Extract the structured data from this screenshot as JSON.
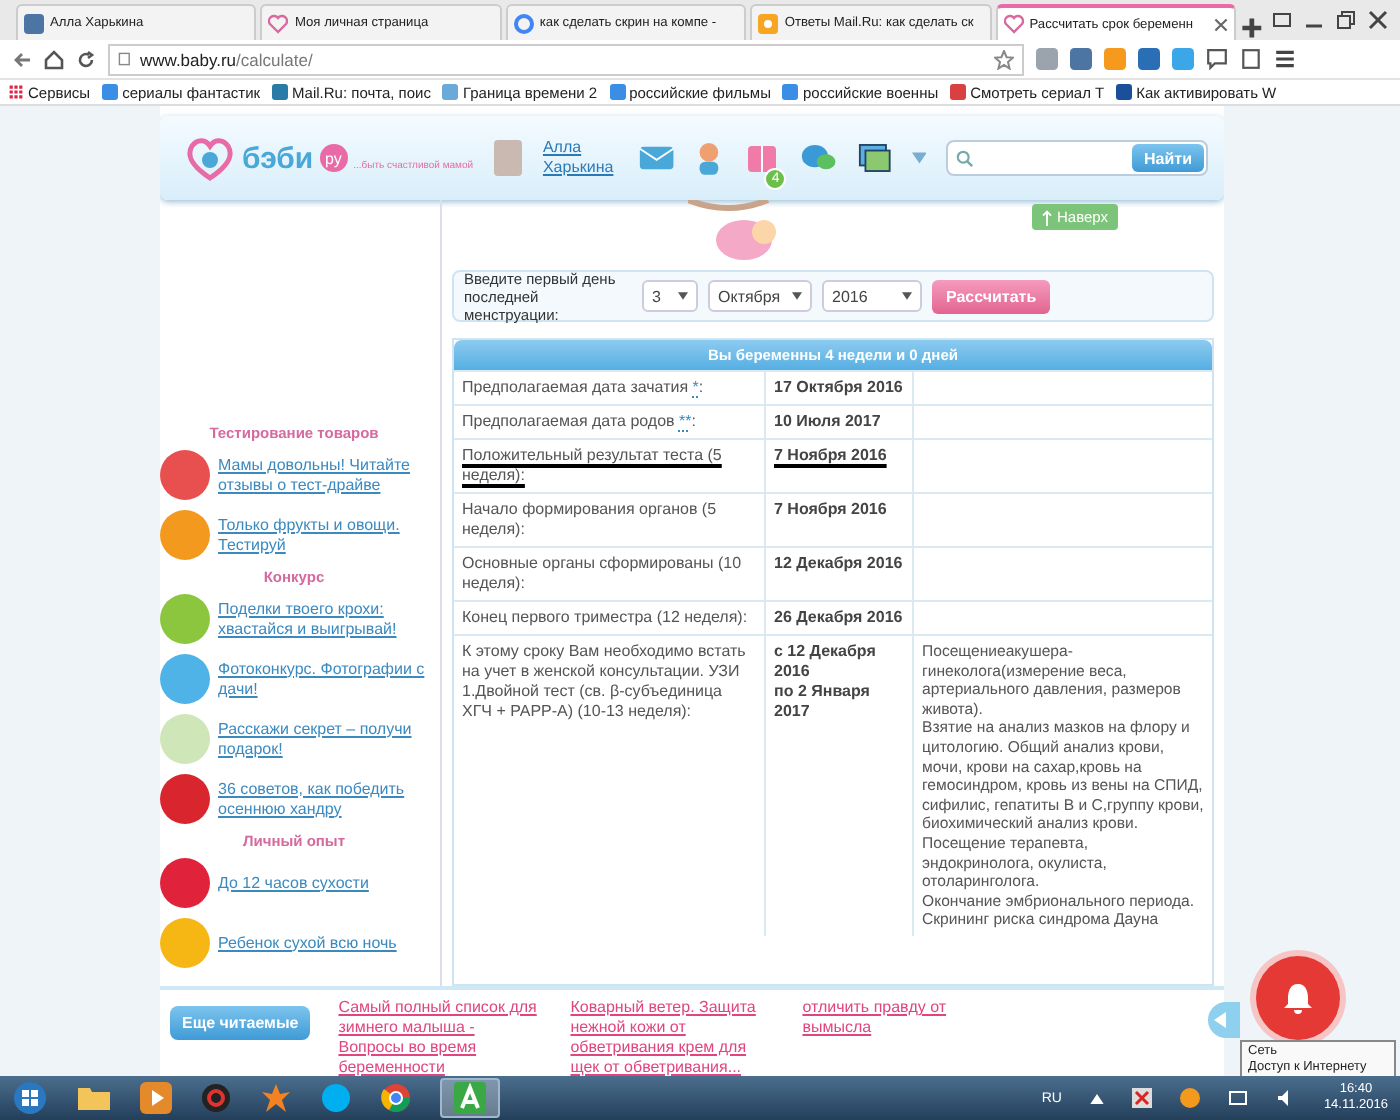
{
  "browser": {
    "tabs": [
      {
        "title": "Алла Харькина",
        "kind": "vk",
        "selected": false
      },
      {
        "title": "Моя личная страница",
        "kind": "baby",
        "selected": false
      },
      {
        "title": "как сделать скрин на компе -",
        "kind": "google",
        "selected": false
      },
      {
        "title": "Ответы Mail.Ru: как сделать ск",
        "kind": "answers",
        "selected": false
      },
      {
        "title": "Рассчитать срок беременн",
        "kind": "baby",
        "selected": true
      }
    ],
    "address": {
      "host": "www.baby.ru",
      "path": "/calculate/"
    },
    "bookmarks": [
      "Сервисы",
      "сериалы фантастик",
      "Mail.Ru: почта, поис",
      "Граница времени 2",
      "российские фильмы",
      "российские военны",
      "Смотреть сериал Т",
      "Как активировать W"
    ]
  },
  "site": {
    "logo": "бэби",
    "logo_badge": "ру",
    "tagline": "...быть счастливой мамой",
    "user": "Алла Харькина",
    "notification_count": "4",
    "search_button": "Найти",
    "top_button": "Наверх"
  },
  "sidebar": [
    {
      "heading": "Тестирование товаров",
      "items": [
        {
          "text": "Мамы довольны! Читайте отзывы о тест-драйве",
          "color": "#e8504f"
        },
        {
          "text": "Только фрукты и овощи. Тестируй",
          "color": "#f39a1e"
        }
      ]
    },
    {
      "heading": "Конкурс",
      "items": [
        {
          "text": "Поделки твоего крохи: хвастайся и выигрывай!",
          "color": "#8cc63f"
        },
        {
          "text": "Фотоконкурс. Фотографии с дачи!",
          "color": "#4fb3e8"
        },
        {
          "text": "Расскажи секрет – получи подарок!",
          "color": "#cfe6b8"
        },
        {
          "text": "36 советов, как победить осеннюю хандру",
          "color": "#d9262e"
        }
      ]
    },
    {
      "heading": "Личный опыт",
      "items": [
        {
          "text": "До 12 часов сухости",
          "color": "#e0223a"
        },
        {
          "text": "Ребенок сухой всю ночь",
          "color": "#f6b614"
        }
      ]
    }
  ],
  "form": {
    "label": "Введите первый день последней менструации:",
    "day": "3",
    "month": "Октября",
    "year": "2016",
    "button": "Рассчитать"
  },
  "result": {
    "title": "Вы беременны 4 недели и 0 дней",
    "rows": [
      {
        "label": "Предполагаемая дата зачатия",
        "note": "*",
        "after": ":",
        "dates": [
          "17 Октября 2016"
        ],
        "marked": false,
        "details": []
      },
      {
        "label": "Предполагаемая дата родов",
        "note": "**",
        "after": ":",
        "dates": [
          "10 Июля 2017"
        ],
        "marked": false,
        "details": []
      },
      {
        "label": "Положительный результат теста (5 неделя):",
        "dates": [
          "7 Ноября 2016"
        ],
        "marked": true,
        "details": []
      },
      {
        "label": "Начало формирования органов (5 неделя):",
        "dates": [
          "7 Ноября 2016"
        ],
        "marked": false,
        "details": []
      },
      {
        "label": "Основные органы сформированы (10 неделя):",
        "dates": [
          "12 Декабря 2016"
        ],
        "marked": false,
        "details": []
      },
      {
        "label": "Конец первого триместра (12 неделя):",
        "dates": [
          "26 Декабря 2016"
        ],
        "marked": false,
        "details": []
      },
      {
        "label": "К этому сроку Вам необходимо встать на учет в женской консультации. УЗИ 1.Двойной тест (св. β-субъединица ХГЧ + PAPP-A) (10-13 неделя):",
        "dates": [
          "с 12 Декабря 2016",
          "по 2 Января 2017"
        ],
        "marked": false,
        "details": [
          "Посещениеакушера-гинеколога(измерение веса, артериального давления, размеров живота).",
          "Взятие на анализ мазков на флору и цитологию. Общий анализ крови, мочи, крови на сахар,кровь на гемосиндром, кровь из вены на СПИД, сифилис, гепатиты В и С,группу крови, биохимический анализ крови.",
          "Посещение терапевта, эндокринолога, окулиста, отоларинголога.",
          "Окончание эмбрионального периода.",
          "Скрининг риска синдрома Дауна"
        ]
      }
    ]
  },
  "more": {
    "button": "Еще читаемые",
    "links": [
      "Самый полный список для зимнего малыша - Вопросы во время беременности",
      "Коварный ветер. Защита нежной кожи от обветривания крем для щек от обветривания...",
      "отличить правду от вымысла"
    ]
  },
  "tooltip": {
    "title": "Сеть",
    "text": "Доступ к Интернету"
  },
  "taskbar": {
    "language": "RU",
    "time": "16:40",
    "date": "14.11.2016"
  }
}
